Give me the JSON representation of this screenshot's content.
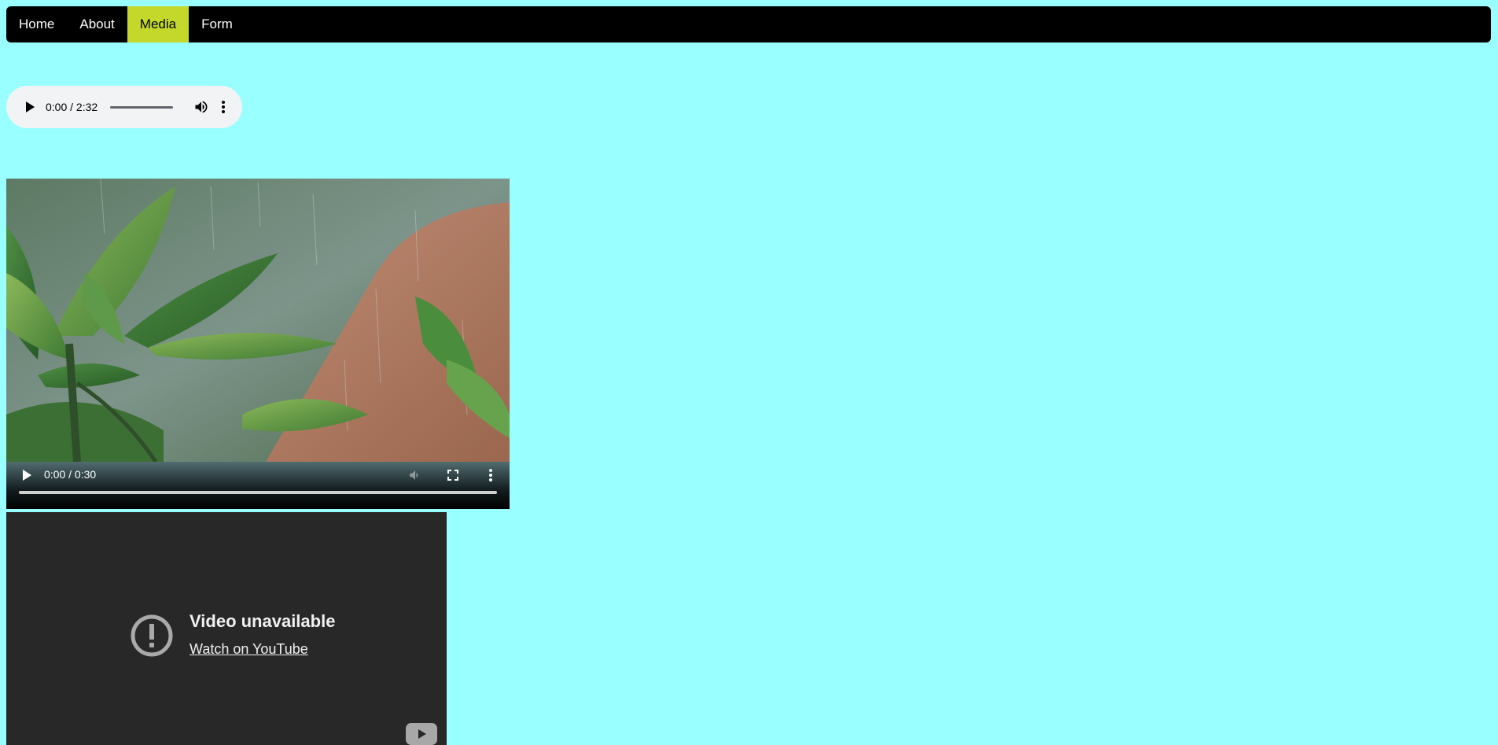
{
  "nav": {
    "items": [
      {
        "label": "Home"
      },
      {
        "label": "About"
      },
      {
        "label": "Media"
      },
      {
        "label": "Form"
      }
    ],
    "active_index": 2,
    "active_color": "#c3d82b"
  },
  "audio": {
    "time": "0:00 / 2:32",
    "progress": 0,
    "icons": {
      "play": "play-icon",
      "volume": "volume-icon",
      "more": "more-vert-icon"
    }
  },
  "video": {
    "time": "0:00 / 0:30",
    "progress": 0,
    "icons": {
      "play": "play-icon",
      "mute": "volume-icon",
      "fullscreen": "fullscreen-icon",
      "more": "more-vert-icon"
    }
  },
  "youtube": {
    "title": "Video unavailable",
    "link": "Watch on YouTube",
    "icons": {
      "error": "alert-circle-icon",
      "logo": "youtube-logo-icon"
    }
  },
  "colors": {
    "page_background": "#99ffff",
    "navbar": "#000000",
    "embed_background": "#282828"
  }
}
